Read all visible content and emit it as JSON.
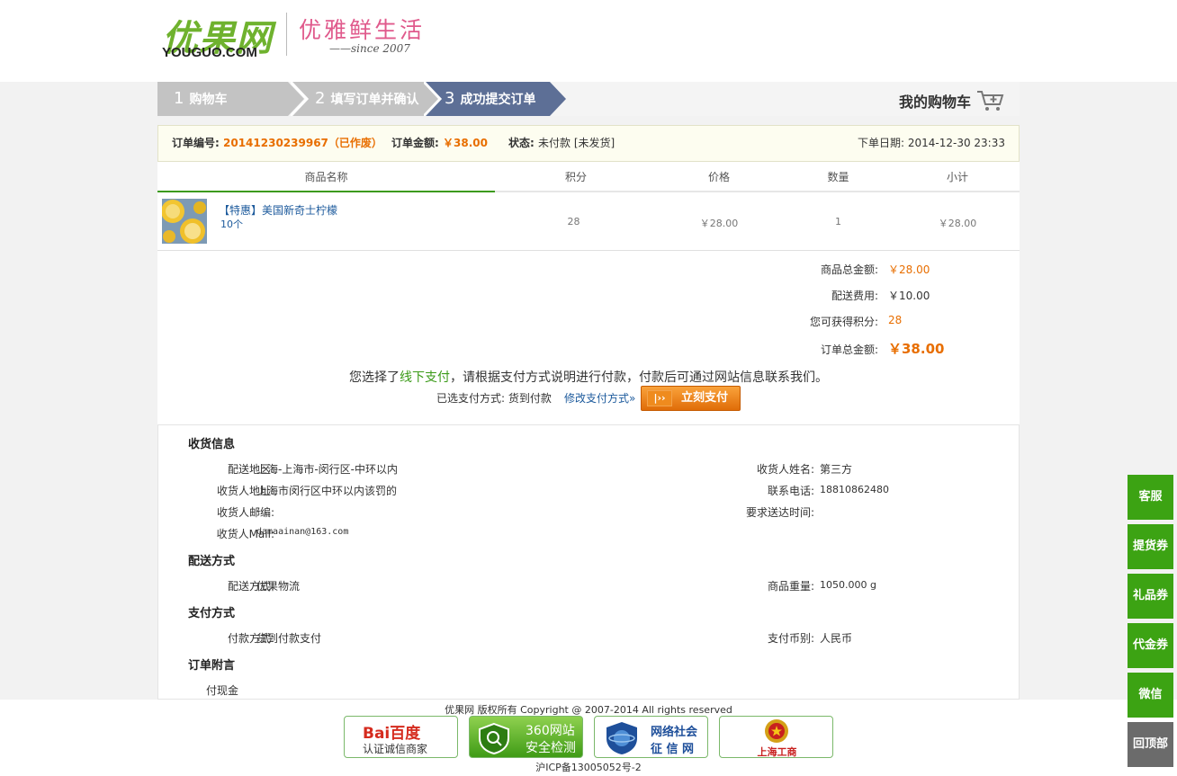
{
  "header": {
    "logo_text": "优果网",
    "logo_sub": "YOUGUO.COM",
    "slogan": "优雅鲜生活",
    "since": "——since 2007"
  },
  "steps": [
    {
      "num": "1",
      "label": "购物车"
    },
    {
      "num": "2",
      "label": "填写订单并确认"
    },
    {
      "num": "3",
      "label": "成功提交订单"
    }
  ],
  "mycart": {
    "label": "我的购物车",
    "icon": "cart-icon"
  },
  "order": {
    "no_label": "订单编号:",
    "no_value": "20141230239967（已作废）",
    "amount_label": "订单金额:",
    "amount_value": "￥38.00",
    "status_label": "状态:",
    "status_value": "未付款 [未发货]",
    "date_label": "下单日期:",
    "date_value": "2014-12-30 23:33"
  },
  "table": {
    "headers": [
      "商品名称",
      "积分",
      "价格",
      "数量",
      "小计"
    ],
    "rows": [
      {
        "name": "【特惠】美国新奇士柠檬",
        "spec": "10个",
        "points": "28",
        "price": "￥28.00",
        "qty": "1",
        "subtotal": "￥28.00"
      }
    ]
  },
  "summary": {
    "goods_total_label": "商品总金额:",
    "goods_total": "￥28.00",
    "shipping_label": "配送费用:",
    "shipping": "￥10.00",
    "points_label": "您可获得积分:",
    "points": "28",
    "order_total_label": "订单总金额:",
    "order_total": "￥38.00"
  },
  "payment_note": {
    "prefix": "您选择了",
    "method_link": "线下支付",
    "suffix": "，请根据支付方式说明进行付款，付款后可通过网站信息联系我们。",
    "selected_label": "已选支付方式:",
    "selected_value": "货到付款",
    "change_link": "修改支付方式»",
    "pay_button": "立刻支付"
  },
  "shipping_info": {
    "title": "收货信息",
    "region_label": "配送地区:",
    "region": "上海-上海市-闵行区-中环以内",
    "name_label": "收货人姓名:",
    "name": "第三方",
    "address_label": "收货人地址:",
    "address": "上海市闵行区中环以内该罚的",
    "phone_label": "联系电话:",
    "phone": "18810862480",
    "zip_label": "收货人邮编:",
    "zip": "-",
    "time_label": "要求送达时间:",
    "time": "",
    "mail_label": "收货人Mail:",
    "mail": "damaainan@163.com"
  },
  "delivery": {
    "title": "配送方式",
    "method_label": "配送方式:",
    "method": "优果物流",
    "weight_label": "商品重量:",
    "weight": "1050.000 g"
  },
  "pay": {
    "title": "支付方式",
    "method_label": "付款方式:",
    "method": "货到付款支付",
    "currency_label": "支付币别:",
    "currency": "人民币"
  },
  "remark": {
    "title": "订单附言",
    "text": "付现金"
  },
  "footer": {
    "copyright": "优果网 版权所有 Copyright @ 2007-2014 All rights reserved",
    "icp": "沪ICP备13005052号-2",
    "badges": [
      {
        "title": "Bai百度",
        "sub": "认证诚信商家"
      },
      {
        "title": "360网站",
        "sub": "安全检测"
      },
      {
        "title": "网络社会",
        "sub": "征 信 网"
      },
      {
        "title": "",
        "sub": "上海工商"
      }
    ]
  },
  "sidebar": [
    "客服",
    "提货券",
    "礼品券",
    "代金券",
    "微信",
    "回顶部"
  ],
  "colors": {
    "green": "#3ca313",
    "orange": "#e86e00",
    "step_active": "#5d6f96",
    "step_inactive": "#c3c3c3"
  }
}
